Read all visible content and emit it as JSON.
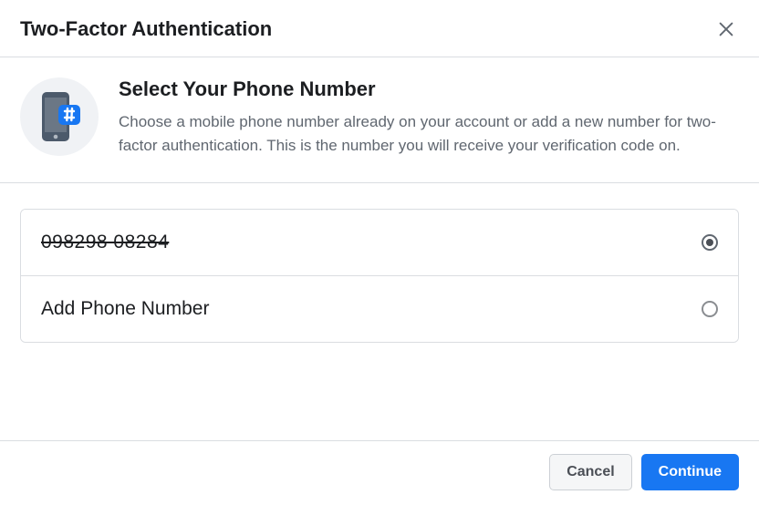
{
  "header": {
    "title": "Two-Factor Authentication"
  },
  "intro": {
    "heading": "Select Your Phone Number",
    "description": "Choose a mobile phone number already on your account or add a new number for two-factor authentication. This is the number you will receive your verification code on."
  },
  "options": [
    {
      "label": "098298 08284",
      "selected": true,
      "masked": true
    },
    {
      "label": "Add Phone Number",
      "selected": false,
      "masked": false
    }
  ],
  "footer": {
    "cancel": "Cancel",
    "continue": "Continue"
  }
}
